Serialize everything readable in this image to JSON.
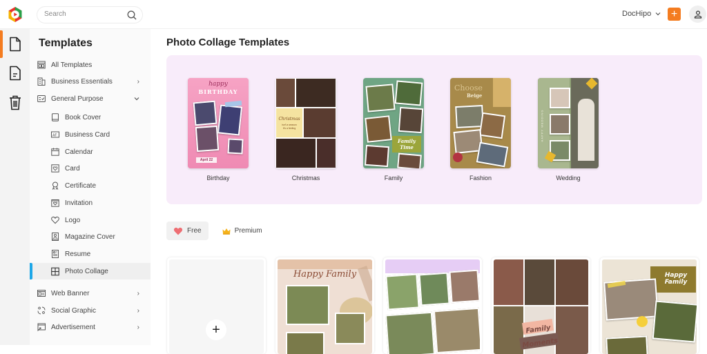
{
  "header": {
    "search_placeholder": "Search",
    "account_name": "DocHipo",
    "create_label": "+",
    "colors": {
      "brand_orange": "#f47c20",
      "active_blue": "#1ea7e8",
      "featured_bg": "#f8ecfa"
    }
  },
  "rail": {
    "items": [
      {
        "name": "templates",
        "icon": "document-icon",
        "active": true
      },
      {
        "name": "my-designs",
        "icon": "file-text-icon",
        "active": false
      },
      {
        "name": "trash",
        "icon": "trash-icon",
        "active": false
      }
    ]
  },
  "sidebar": {
    "title": "Templates",
    "items": [
      {
        "label": "All Templates",
        "icon": "grid-icon",
        "level": "top",
        "chevron": ""
      },
      {
        "label": "Business Essentials",
        "icon": "building-icon",
        "level": "top",
        "chevron": "›"
      },
      {
        "label": "General Purpose",
        "icon": "checklist-icon",
        "level": "top",
        "chevron": "⌄"
      },
      {
        "label": "Book Cover",
        "icon": "book-icon",
        "level": "sub"
      },
      {
        "label": "Business Card",
        "icon": "id-card-icon",
        "level": "sub"
      },
      {
        "label": "Calendar",
        "icon": "calendar-icon",
        "level": "sub"
      },
      {
        "label": "Card",
        "icon": "heart-card-icon",
        "level": "sub"
      },
      {
        "label": "Certificate",
        "icon": "ribbon-icon",
        "level": "sub"
      },
      {
        "label": "Invitation",
        "icon": "invitation-icon",
        "level": "sub"
      },
      {
        "label": "Logo",
        "icon": "heart-icon",
        "level": "sub"
      },
      {
        "label": "Magazine Cover",
        "icon": "magazine-icon",
        "level": "sub"
      },
      {
        "label": "Resume",
        "icon": "resume-icon",
        "level": "sub"
      },
      {
        "label": "Photo Collage",
        "icon": "collage-icon",
        "level": "sub",
        "selected": true
      },
      {
        "label": "Web Banner",
        "icon": "banner-icon",
        "level": "top",
        "chevron": "›"
      },
      {
        "label": "Social Graphic",
        "icon": "social-icon",
        "level": "top",
        "chevron": "›"
      },
      {
        "label": "Advertisement",
        "icon": "advert-icon",
        "level": "top",
        "chevron": "›"
      }
    ]
  },
  "main": {
    "title": "Photo Collage Templates",
    "featured": [
      {
        "label": "Birthday",
        "thumb_text": [
          "happy",
          "BIRTHDAY",
          "April 22"
        ]
      },
      {
        "label": "Christmas",
        "thumb_text": [
          "Christmas",
          "isn't a season",
          "it's a feeling"
        ]
      },
      {
        "label": "Family",
        "thumb_text": [
          "Family",
          "Time"
        ]
      },
      {
        "label": "Fashion",
        "thumb_text": [
          "Choose",
          "Beige"
        ]
      },
      {
        "label": "Wedding",
        "thumb_text": [
          "HAPPY WEDDING"
        ]
      }
    ],
    "filters": [
      {
        "label": "Free",
        "icon": "heart-icon",
        "active": true
      },
      {
        "label": "Premium",
        "icon": "crown-icon",
        "active": false
      }
    ],
    "grid": [
      {
        "type": "blank",
        "action": "+"
      },
      {
        "type": "template",
        "thumb_text": "Happy Family"
      },
      {
        "type": "template",
        "thumb_text": ""
      },
      {
        "type": "template",
        "thumb_text": "Family Moments"
      },
      {
        "type": "template",
        "thumb_text": "Happy Family"
      }
    ]
  }
}
